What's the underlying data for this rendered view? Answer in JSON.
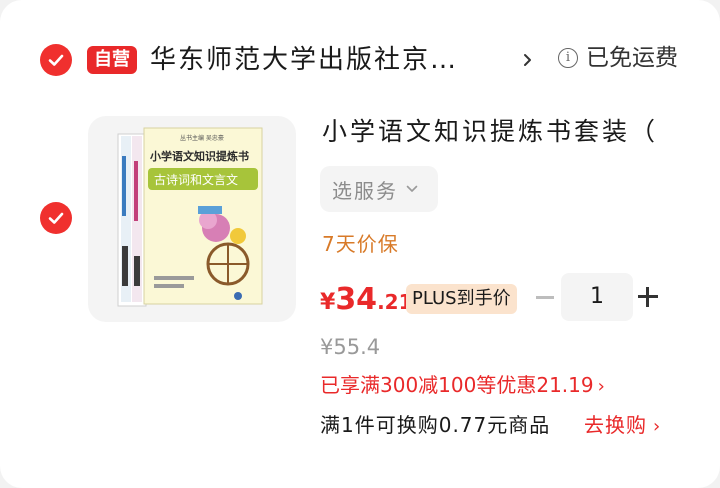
{
  "store": {
    "badge": "自营",
    "name": "华东师范大学出版社京…",
    "shipping": "已免运费"
  },
  "item": {
    "title": "小学语文知识提炼书套装（",
    "service_button": "选服务",
    "price_protection": "7天价保",
    "price": {
      "currency": "¥",
      "integer": "34",
      "decimal": ".21"
    },
    "plus_tag": "PLUS到手价",
    "quantity": "1",
    "original_price": "¥55.4",
    "discount_text": "已享满300减100等优惠21.19",
    "exchange_text": "满1件可换购0.77元商品",
    "exchange_link": "去换购",
    "book_cover": {
      "series_title": "小学语文知识提炼书",
      "volume_title": "古诗词和文言文",
      "small_top_text": "丛书主编 吴忠豪"
    }
  },
  "colors": {
    "accent_red": "#e9292a",
    "price_protect_orange": "#d87a28",
    "plus_tag_bg": "#fbe3cd"
  }
}
